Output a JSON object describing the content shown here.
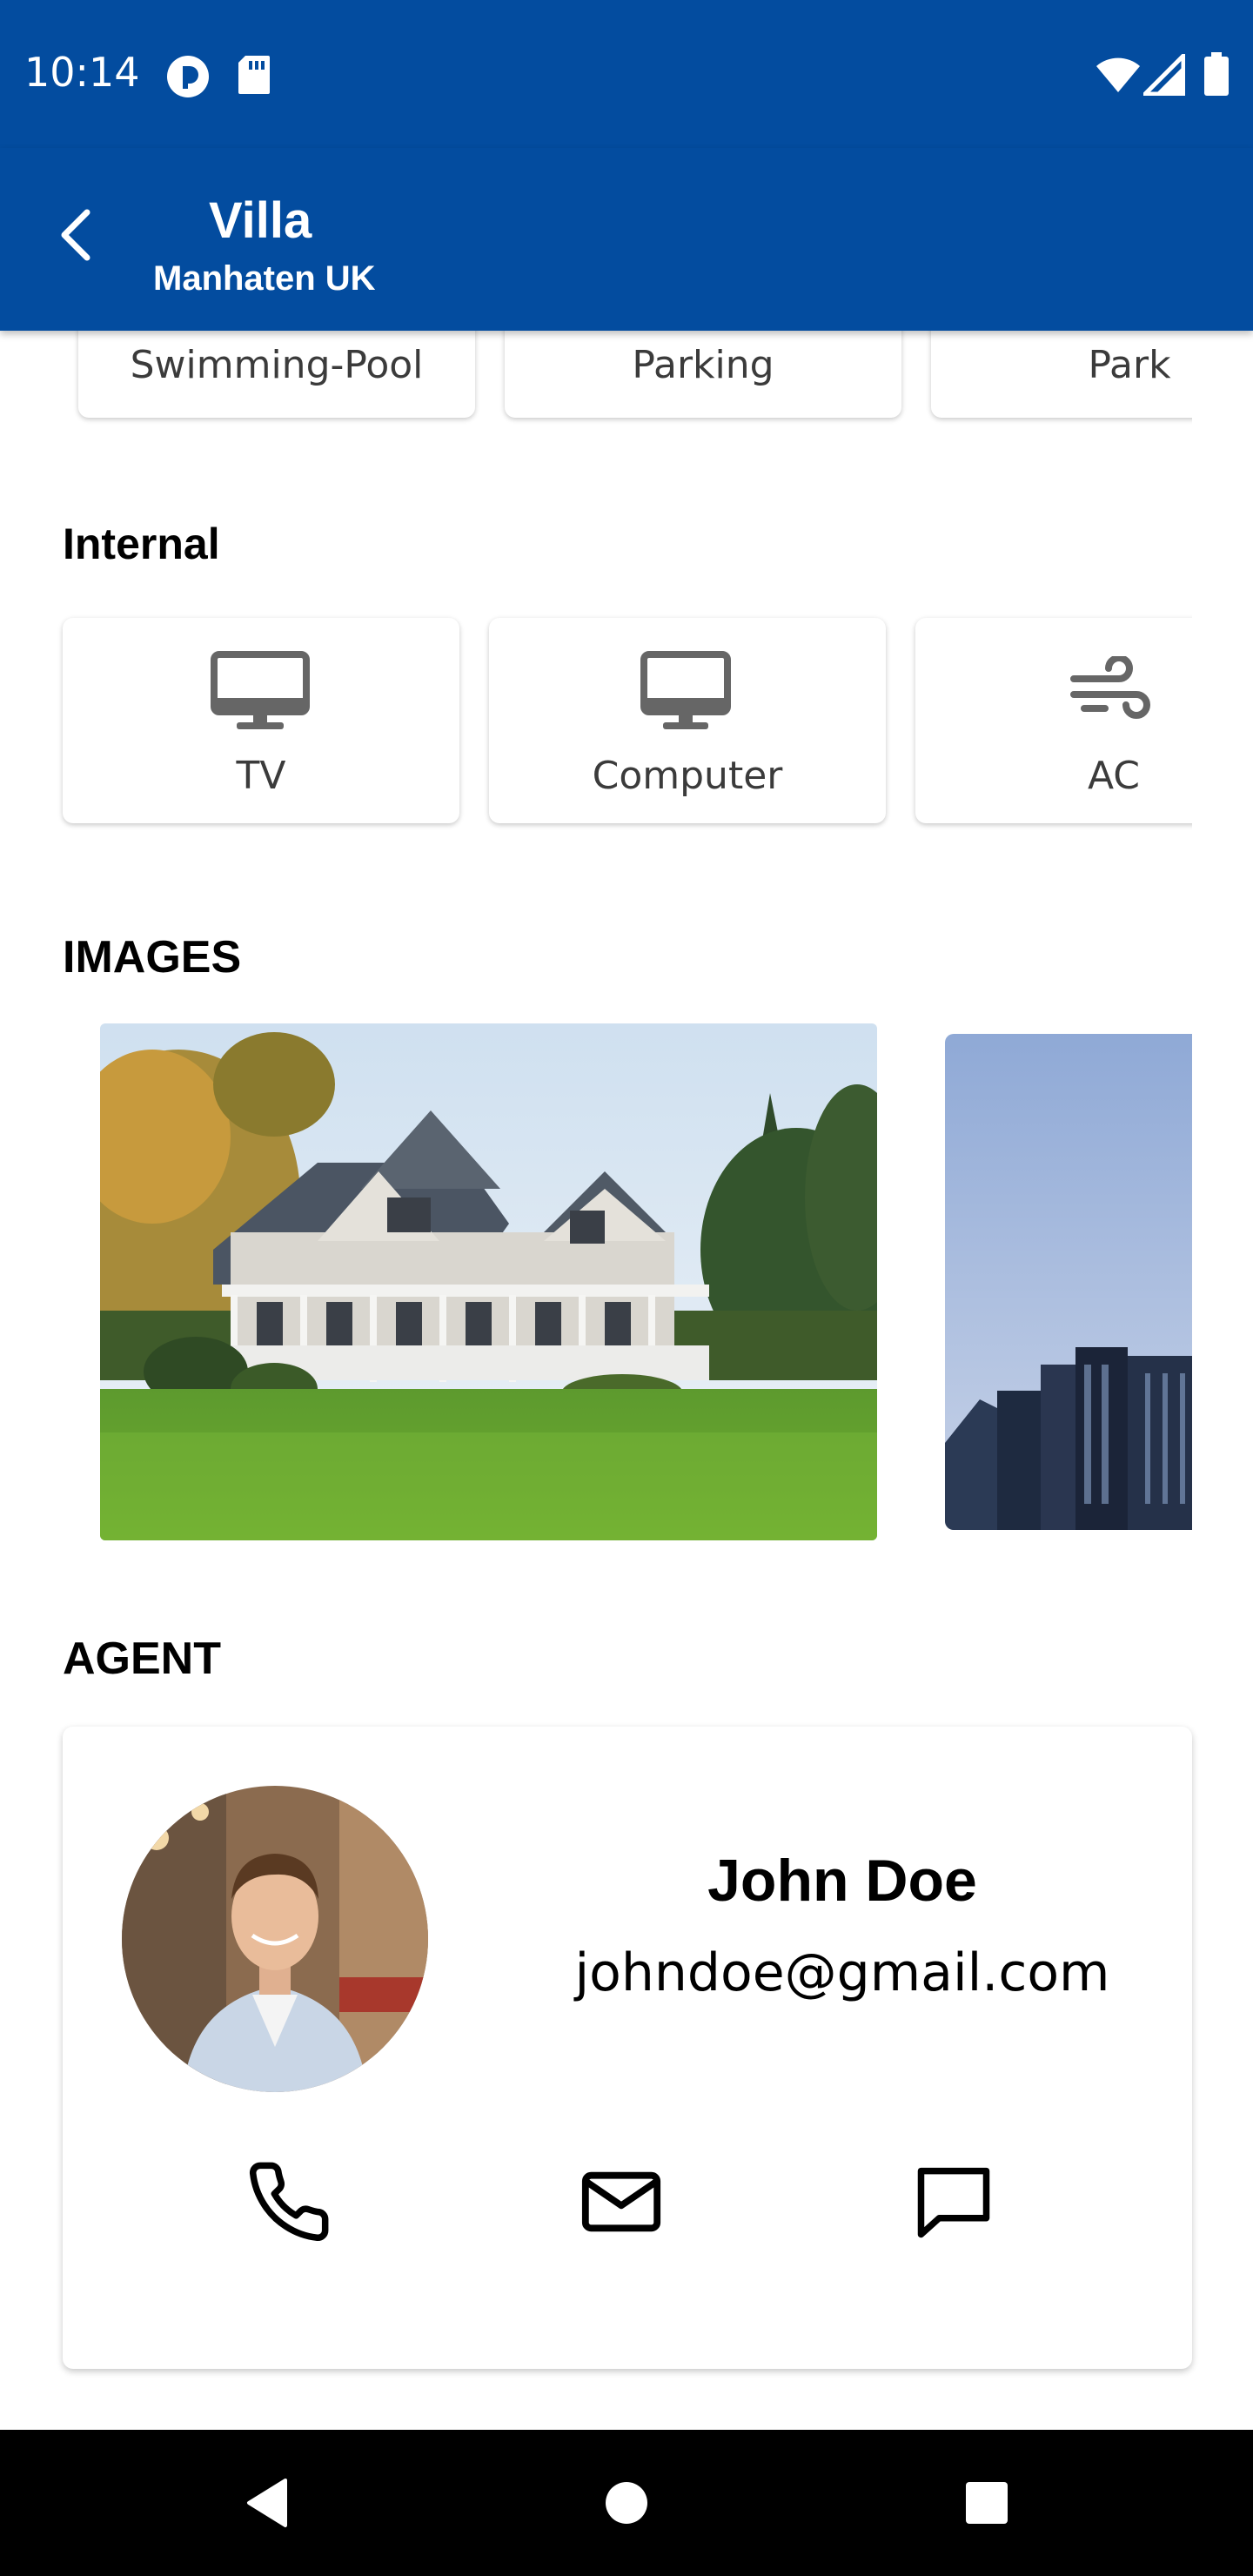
{
  "status_bar": {
    "time": "10:14",
    "icons": [
      "notification-app-icon",
      "sd-card-icon",
      "wifi-icon",
      "cell-signal-icon",
      "battery-icon"
    ]
  },
  "app_bar": {
    "title": "Villa",
    "subtitle": "Manhaten UK",
    "back_icon": "arrow-left-icon",
    "color": "#034c9f"
  },
  "external": {
    "items": [
      {
        "label": "Swimming-Pool",
        "icon": "pool-icon"
      },
      {
        "label": "Parking",
        "icon": "parking-icon"
      },
      {
        "label": "Park",
        "icon": "tree-icon"
      }
    ]
  },
  "internal": {
    "title": "Internal",
    "items": [
      {
        "label": "TV",
        "icon": "monitor-icon"
      },
      {
        "label": "Computer",
        "icon": "monitor-icon"
      },
      {
        "label": "AC",
        "icon": "wind-icon"
      }
    ]
  },
  "images": {
    "title": "IMAGES",
    "items": [
      "house-photo",
      "city-buildings-photo"
    ]
  },
  "agent": {
    "title": "AGENT",
    "name": "John Doe",
    "email": "johndoe@gmail.com",
    "actions": [
      "phone-icon",
      "mail-icon",
      "message-icon"
    ]
  },
  "nav_bar": {
    "buttons": [
      "back-triangle-icon",
      "home-circle-icon",
      "recents-square-icon"
    ]
  }
}
